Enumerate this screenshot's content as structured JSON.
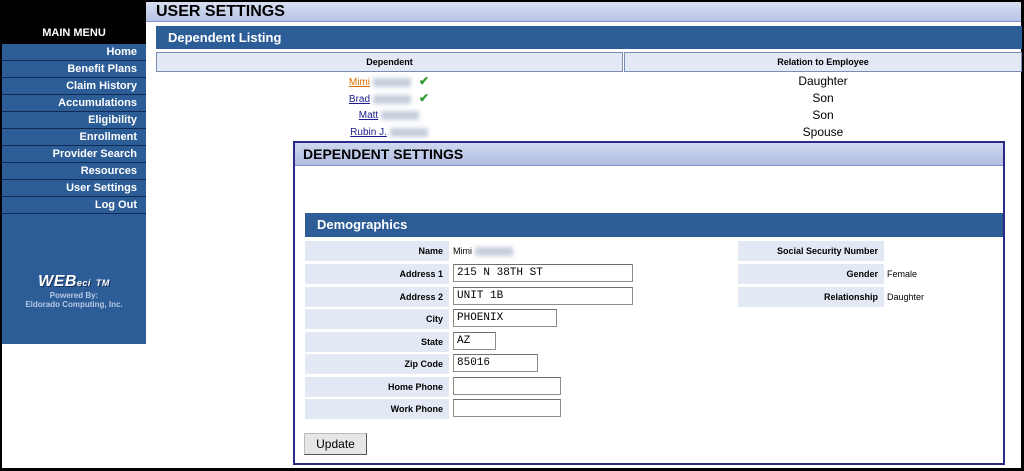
{
  "page_title": "USER SETTINGS",
  "sidebar": {
    "header": "MAIN MENU",
    "items": [
      {
        "label": "Home"
      },
      {
        "label": "Benefit Plans"
      },
      {
        "label": "Claim History"
      },
      {
        "label": "Accumulations"
      },
      {
        "label": "Eligibility"
      },
      {
        "label": "Enrollment"
      },
      {
        "label": "Provider Search"
      },
      {
        "label": "Resources"
      },
      {
        "label": "User Settings"
      },
      {
        "label": "Log Out"
      }
    ],
    "logo": {
      "text": "WEB",
      "suffix": "eci",
      "tm": "TM",
      "powered_by": "Powered By:",
      "company": "Eldorado Computing, Inc."
    }
  },
  "dependent_listing": {
    "title": "Dependent Listing",
    "columns": [
      "Dependent",
      "Relation to Employee"
    ],
    "rows": [
      {
        "name": "Mimi",
        "relation": "Daughter",
        "checked": true,
        "active": true
      },
      {
        "name": "Brad",
        "relation": "Son",
        "checked": true,
        "active": false
      },
      {
        "name": "Matt",
        "relation": "Son",
        "checked": false,
        "active": false
      },
      {
        "name": "Rubin J.",
        "relation": "Spouse",
        "checked": false,
        "active": false
      }
    ]
  },
  "dependent_settings": {
    "title": "DEPENDENT SETTINGS",
    "demographics_title": "Demographics",
    "fields": {
      "name": {
        "label": "Name",
        "value": "Mimi"
      },
      "address1": {
        "label": "Address 1",
        "value": "215 N 38TH ST"
      },
      "address2": {
        "label": "Address 2",
        "value": "UNIT 1B"
      },
      "city": {
        "label": "City",
        "value": "PHOENIX"
      },
      "state": {
        "label": "State",
        "value": "AZ"
      },
      "zip": {
        "label": "Zip Code",
        "value": "85016"
      },
      "home_phone": {
        "label": "Home Phone",
        "value": ""
      },
      "work_phone": {
        "label": "Work Phone",
        "value": ""
      },
      "ssn": {
        "label": "Social Security Number",
        "value": ""
      },
      "gender": {
        "label": "Gender",
        "value": "Female"
      },
      "relationship": {
        "label": "Relationship",
        "value": "Daughter"
      }
    },
    "update_label": "Update"
  },
  "colors": {
    "nav_blue": "#2d5d96",
    "header_light": "#b8c4e6",
    "label_bg": "#e2e9f5",
    "active_link": "#e06d00",
    "link": "#1a1a8c",
    "check": "#2e9a2e"
  }
}
